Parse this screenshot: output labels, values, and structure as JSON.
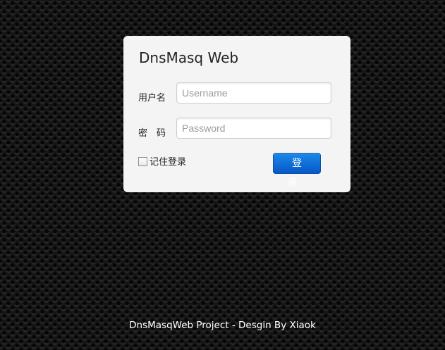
{
  "login": {
    "title": "DnsMasq Web",
    "username_label": "用户名",
    "username_placeholder": "Username",
    "username_value": "",
    "password_label": "密码",
    "password_placeholder": "Password",
    "password_value": "",
    "remember_label": "记住登录",
    "remember_checked": false,
    "submit_label": "登录"
  },
  "footer": {
    "text": "DnsMasqWeb Project - Desgin By Xiaok"
  },
  "colors": {
    "page_background": "#161616",
    "panel_background": "#f4f4f4",
    "button_background": "#0a6ad6",
    "footer_text": "#ffffff"
  }
}
